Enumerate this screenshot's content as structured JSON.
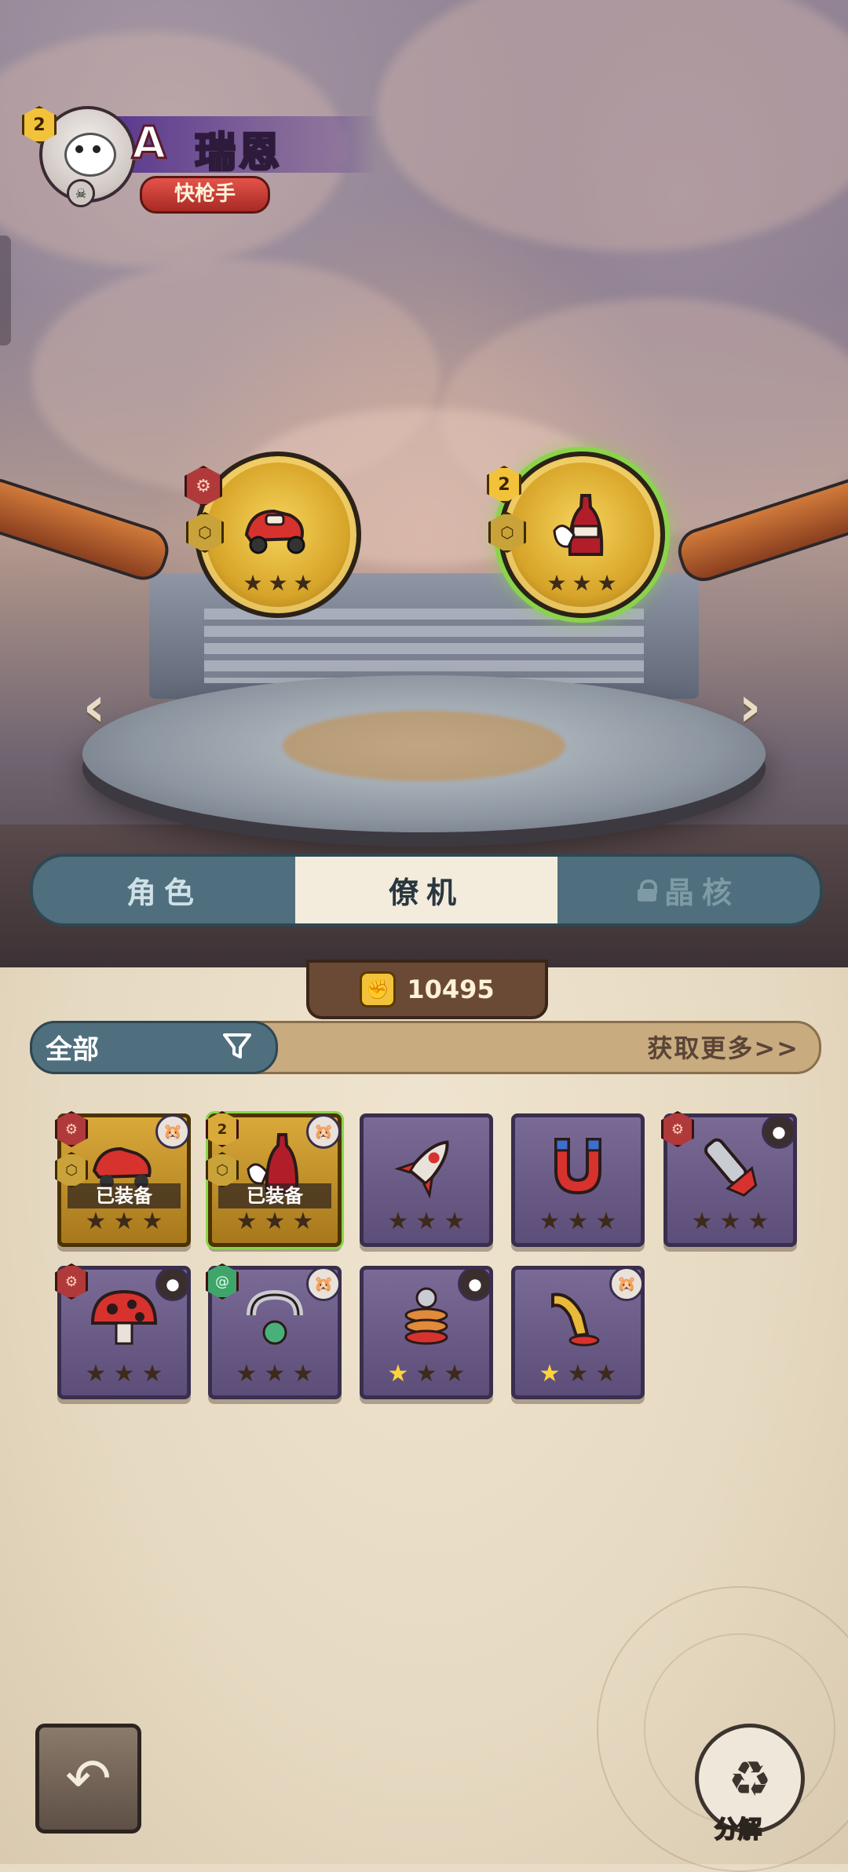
{
  "hero": {
    "level": "2",
    "rank": "A",
    "name": "瑞恩",
    "title": "快枪手"
  },
  "equipped_slots": [
    {
      "name": "roller-skate",
      "level": "",
      "stars_lit": 0,
      "stars_total": 3,
      "selected": false
    },
    {
      "name": "cola-bottle",
      "level": "2",
      "stars_lit": 0,
      "stars_total": 3,
      "selected": true
    }
  ],
  "tabs": [
    {
      "label": "角色",
      "state": "normal"
    },
    {
      "label": "僚机",
      "state": "active"
    },
    {
      "label": "晶核",
      "state": "locked"
    }
  ],
  "currency": {
    "icon": "fist-icon",
    "amount": "10495"
  },
  "filter": {
    "label": "全部",
    "icon": "funnel-icon",
    "get_more": "获取更多>>"
  },
  "inventory": [
    {
      "item": "roller-skate",
      "frame": "gold",
      "equipped_label": "已装备",
      "stars_lit": 0
    },
    {
      "item": "cola-bottle",
      "frame": "gold-green",
      "level": "2",
      "equipped_label": "已装备",
      "stars_lit": 0
    },
    {
      "item": "rocket",
      "frame": "purple",
      "stars_lit": 0
    },
    {
      "item": "magnet",
      "frame": "purple",
      "stars_lit": 0
    },
    {
      "item": "cannon",
      "frame": "purple",
      "stars_lit": 0
    },
    {
      "item": "mushroom",
      "frame": "purple",
      "stars_lit": 0
    },
    {
      "item": "ring-claw",
      "frame": "purple",
      "stars_lit": 0
    },
    {
      "item": "spring-bomb",
      "frame": "purple",
      "stars_lit": 1
    },
    {
      "item": "horn",
      "frame": "purple",
      "stars_lit": 1
    }
  ],
  "buttons": {
    "back_icon": "back-arrow-icon",
    "decompose_label": "分解"
  },
  "colors": {
    "tab_bg": "#4f6f7e",
    "active_tab": "#f3ecdc",
    "gold": "#d9a93a",
    "purple_card": "#6a5a88",
    "glow": "#8ad44a"
  }
}
